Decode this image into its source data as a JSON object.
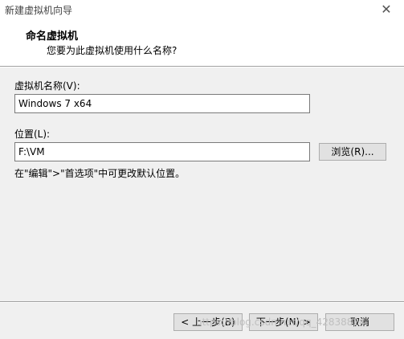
{
  "window": {
    "title": "新建虚拟机向导",
    "close_glyph": "✕"
  },
  "header": {
    "title": "命名虚拟机",
    "subtitle": "您要为此虚拟机使用什么名称?"
  },
  "form": {
    "name_label": "虚拟机名称(V):",
    "name_value": "Windows 7 x64",
    "location_label": "位置(L):",
    "location_value": "F:\\VM",
    "browse_label": "浏览(R)...",
    "hint": "在\"编辑\">\"首选项\"中可更改默认位置。"
  },
  "footer": {
    "back_label": "< 上一步(B)",
    "next_label": "下一步(N) >",
    "cancel_label": "取消"
  },
  "watermark": "https://blog.csdn.net/qq_42838824"
}
